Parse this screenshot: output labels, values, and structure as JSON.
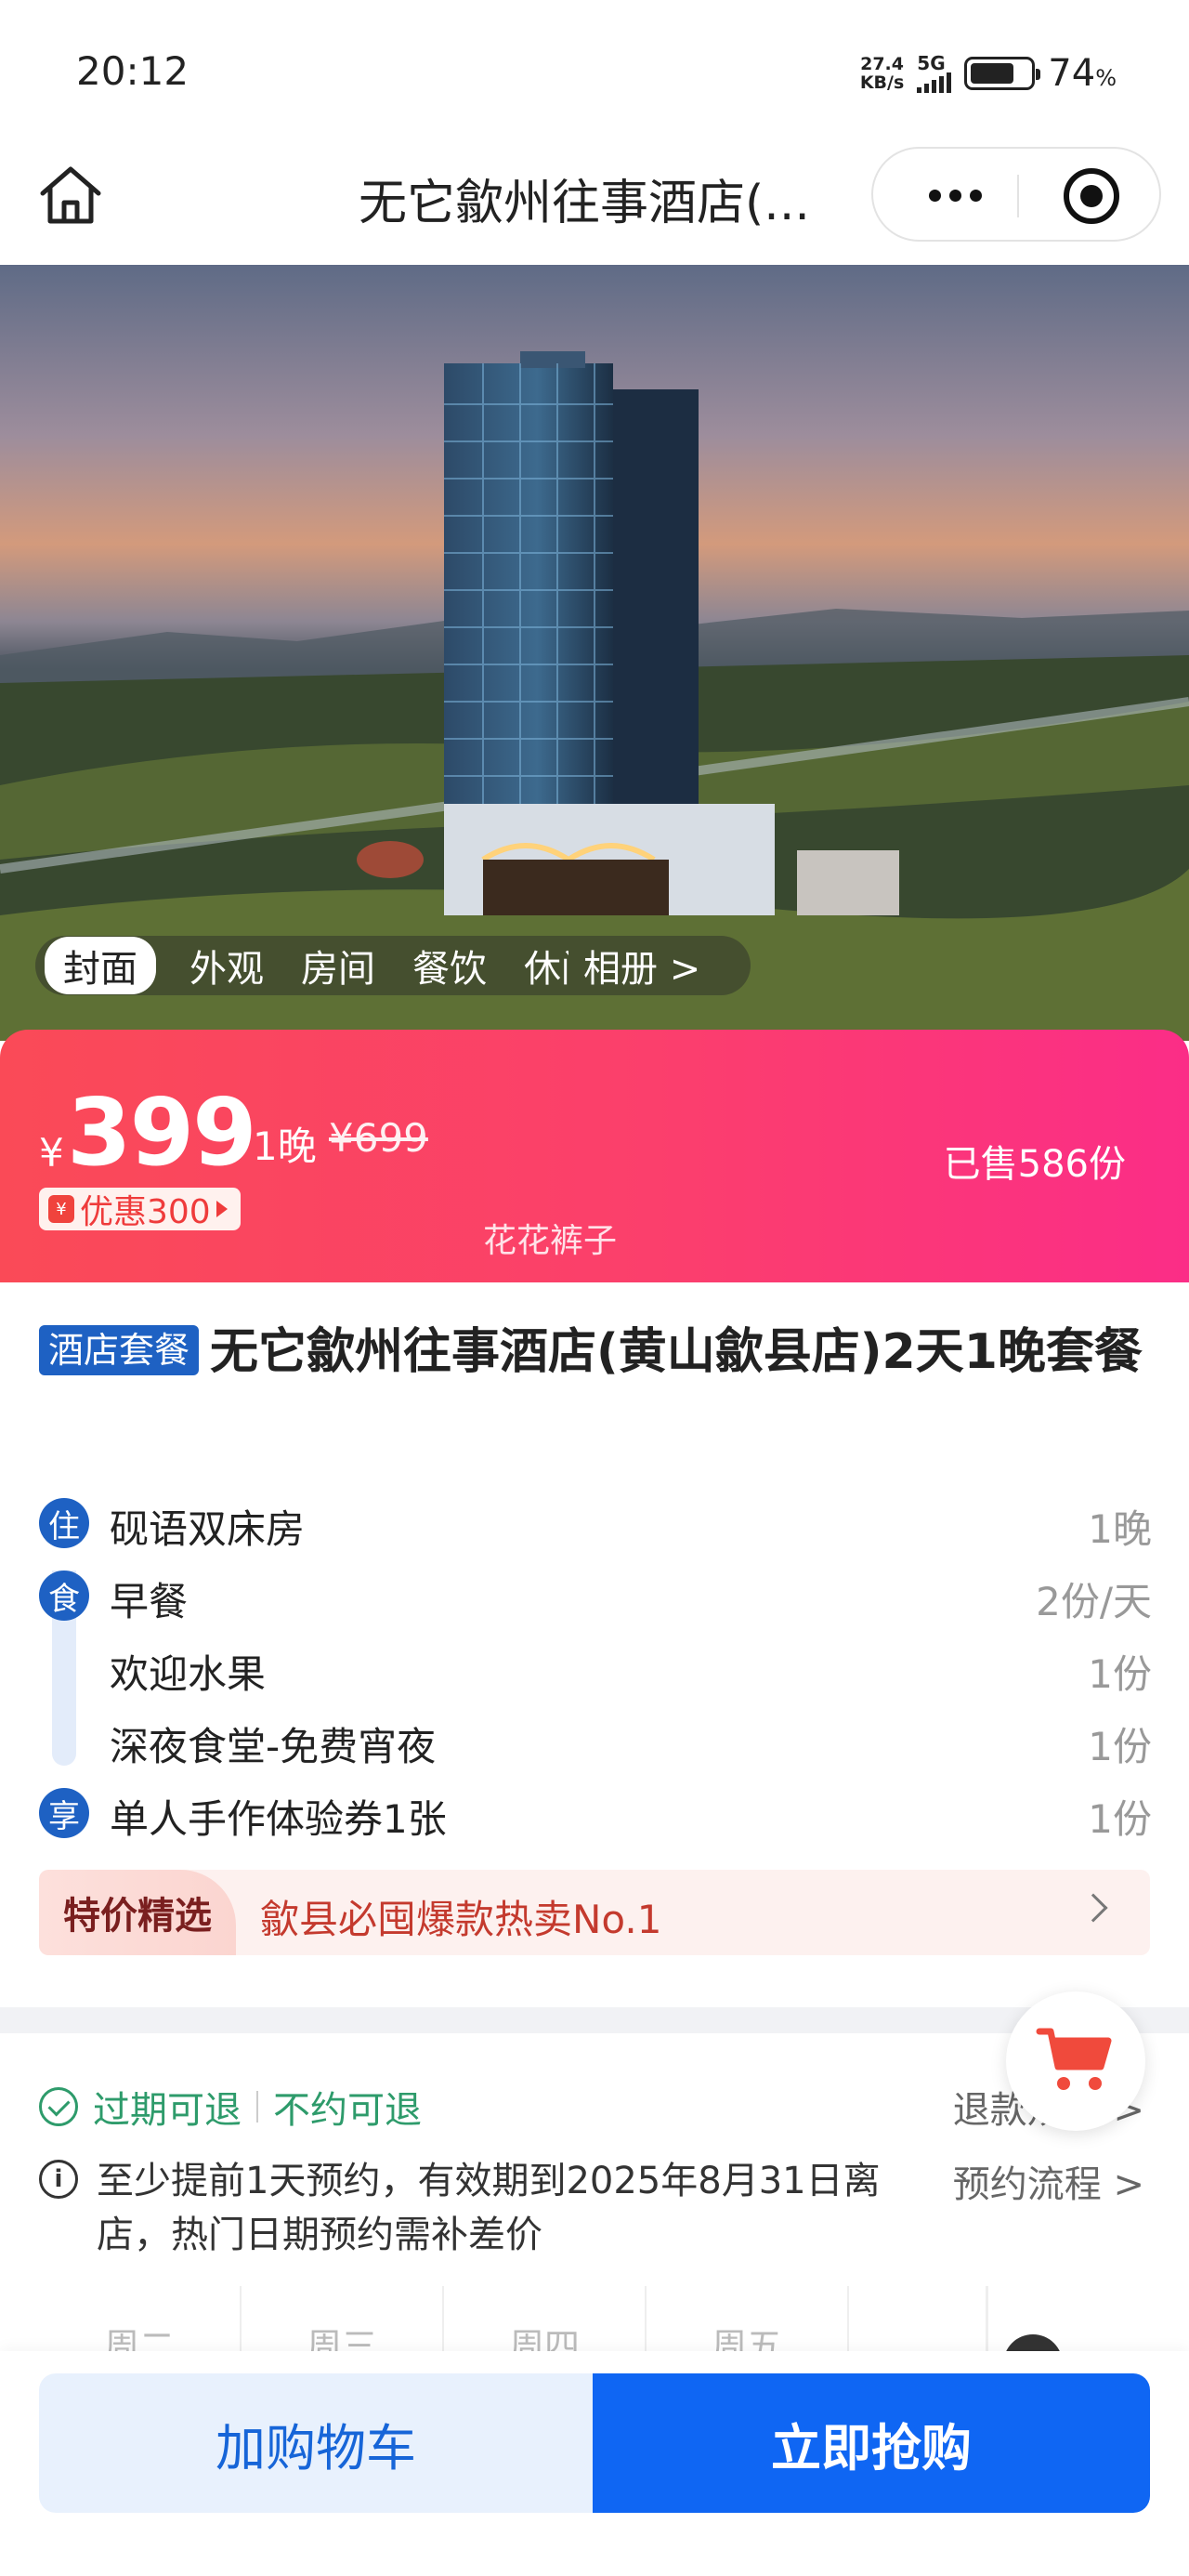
{
  "status_bar": {
    "time": "20:12",
    "speed_value": "27.4",
    "speed_unit": "KB/s",
    "network": "5G",
    "battery_value": "74",
    "battery_unit": "%",
    "battery_level": 0.74
  },
  "nav": {
    "title": "无它歙州往事酒店(..."
  },
  "hero": {
    "tabs": [
      "封面",
      "外观",
      "房间",
      "餐饮",
      "休闲"
    ],
    "album": "相册 >"
  },
  "price": {
    "currency": "¥",
    "amount": "399",
    "unit": "1晚",
    "original": "¥699",
    "discount": "优惠300",
    "sold": "已售586份",
    "watermark": "花花裤子"
  },
  "title": {
    "tag": "酒店套餐",
    "text": "无它歙州往事酒店(黄山歙县店)2天1晚套餐"
  },
  "items": [
    {
      "badge": "住",
      "name": "砚语双床房",
      "qty": "1晚"
    },
    {
      "badge": "食",
      "name": "早餐",
      "qty": "2份/天"
    },
    {
      "badge": "",
      "name": "欢迎水果",
      "qty": "1份"
    },
    {
      "badge": "",
      "name": "深夜食堂-免费宵夜",
      "qty": "1份"
    },
    {
      "badge": "享",
      "name": "单人手作体验券1张",
      "qty": "1份"
    }
  ],
  "special": {
    "tag": "特价精选",
    "text": "歙县必囤爆款热卖No.1"
  },
  "refund": {
    "expired": "过期可退",
    "unused": "不约可退",
    "link": "退款规则 >"
  },
  "notice": {
    "text": "至少提前1天预约，有效期到2025年8月31日离店，热门日期预约需补差价",
    "flow_link": "预约流程 >"
  },
  "week": [
    "周二",
    "周三",
    "周四",
    "周五"
  ],
  "bottom": {
    "cart_label": "加购物车",
    "buy_label": "立即抢购"
  },
  "colors": {
    "brand_blue": "#1e61c3",
    "buy_blue": "#0f66f3",
    "price_gradient_start": "#fa4a57",
    "price_gradient_end": "#fb2d87",
    "refund_green": "#2e9b6b",
    "special_red": "#c43a2e"
  }
}
